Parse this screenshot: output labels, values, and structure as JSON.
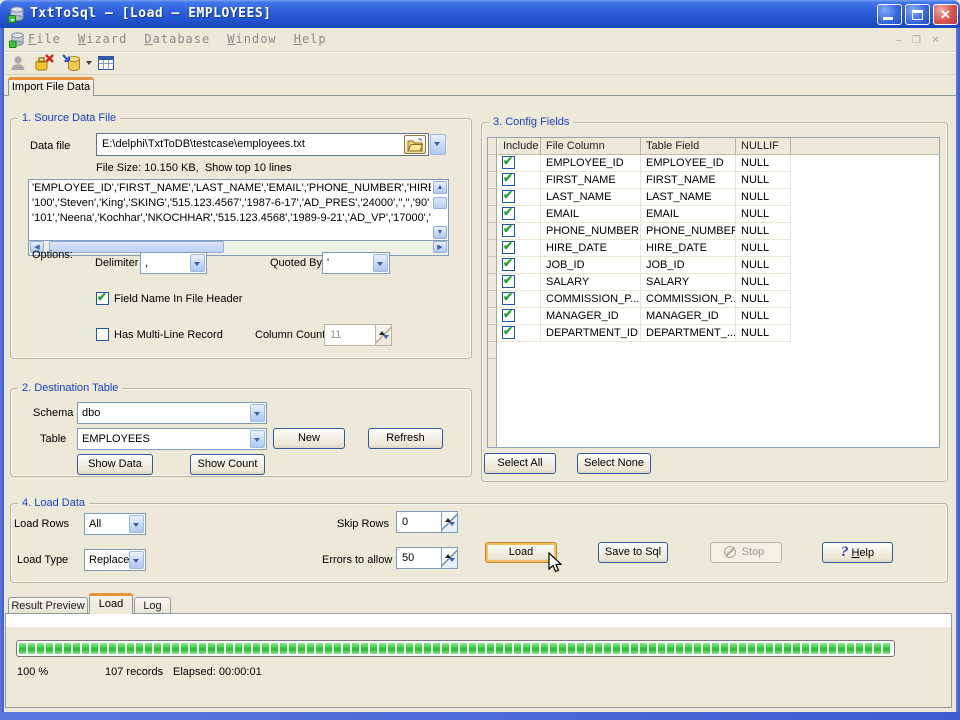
{
  "window": {
    "title": "TxtToSql – [Load – EMPLOYEES]"
  },
  "menu": {
    "items": [
      "File",
      "Wizard",
      "Database",
      "Window",
      "Help"
    ]
  },
  "tabs": {
    "main": "Import File Data"
  },
  "source": {
    "legend": "1. Source Data File",
    "data_file_label": "Data file",
    "data_file_value": "E:\\delphi\\TxtToDB\\testcase\\employees.txt",
    "file_info": "File Size: 10.150 KB,  Show top 10 lines",
    "preview_lines": [
      "'EMPLOYEE_ID','FIRST_NAME','LAST_NAME','EMAIL','PHONE_NUMBER','HIRE",
      "'100','Steven','King','SKING','515.123.4567','1987-6-17','AD_PRES','24000','','','90'",
      "'101','Neena','Kochhar','NKOCHHAR','515.123.4568','1989-9-21','AD_VP','17000','','"
    ],
    "options_label": "Options:",
    "delimiter_label": "Delimiter",
    "delimiter_value": ",",
    "quoted_by_label": "Quoted By",
    "quoted_by_value": "'",
    "field_name_checkbox": "Field Name In File Header",
    "field_name_checked": true,
    "multiline_checkbox": "Has Multi-Line Record",
    "multiline_checked": false,
    "column_count_label": "Column Count",
    "column_count_value": "11"
  },
  "destination": {
    "legend": "2. Destination Table",
    "schema_label": "Schema",
    "schema_value": "dbo",
    "table_label": "Table",
    "table_value": "EMPLOYEES",
    "new_button": "New",
    "refresh_button": "Refresh",
    "show_data_button": "Show Data",
    "show_count_button": "Show Count"
  },
  "config_fields": {
    "legend": "3. Config Fields",
    "columns": [
      "Include",
      "File Column",
      "Table Field",
      "NULLIF"
    ],
    "rows": [
      {
        "include": true,
        "file_column": "EMPLOYEE_ID",
        "table_field": "EMPLOYEE_ID",
        "nullif": "NULL"
      },
      {
        "include": true,
        "file_column": "FIRST_NAME",
        "table_field": "FIRST_NAME",
        "nullif": "NULL"
      },
      {
        "include": true,
        "file_column": "LAST_NAME",
        "table_field": "LAST_NAME",
        "nullif": "NULL"
      },
      {
        "include": true,
        "file_column": "EMAIL",
        "table_field": "EMAIL",
        "nullif": "NULL"
      },
      {
        "include": true,
        "file_column": "PHONE_NUMBER",
        "table_field": "PHONE_NUMBER",
        "nullif": "NULL"
      },
      {
        "include": true,
        "file_column": "HIRE_DATE",
        "table_field": "HIRE_DATE",
        "nullif": "NULL"
      },
      {
        "include": true,
        "file_column": "JOB_ID",
        "table_field": "JOB_ID",
        "nullif": "NULL"
      },
      {
        "include": true,
        "file_column": "SALARY",
        "table_field": "SALARY",
        "nullif": "NULL"
      },
      {
        "include": true,
        "file_column": "COMMISSION_P...",
        "table_field": "COMMISSION_P...",
        "nullif": "NULL"
      },
      {
        "include": true,
        "file_column": "MANAGER_ID",
        "table_field": "MANAGER_ID",
        "nullif": "NULL"
      },
      {
        "include": true,
        "file_column": "DEPARTMENT_ID",
        "table_field": "DEPARTMENT_...",
        "nullif": "NULL"
      }
    ],
    "select_all_button": "Select All",
    "select_none_button": "Select None"
  },
  "load_data": {
    "legend": "4. Load Data",
    "load_rows_label": "Load Rows",
    "load_rows_value": "All",
    "load_type_label": "Load Type",
    "load_type_value": "Replace",
    "skip_rows_label": "Skip Rows",
    "skip_rows_value": "0",
    "errors_label": "Errors to allow",
    "errors_value": "50",
    "load_button": "Load",
    "save_button": "Save to Sql",
    "stop_button": "Stop",
    "help_button": "Help"
  },
  "bottom_tabs": [
    "Result Preview",
    "Load",
    "Log"
  ],
  "progress": {
    "percent": "100 %",
    "records": "107 records",
    "elapsed": "Elapsed: 00:00:01"
  },
  "icons": {
    "check": "✔",
    "close": "✕",
    "help": "?",
    "mdi_minimize": "–",
    "mdi_restore": "❐",
    "mdi_close": "✕",
    "scroll_up": "▲",
    "scroll_down": "▼",
    "scroll_left": "◀",
    "scroll_right": "▶"
  },
  "colors": {
    "accent_blue": "#1B41C8",
    "check_green": "#21A32A",
    "progress_green": "#3ECB44",
    "tab_orange": "#E7913C",
    "titlebar_blue": "#2254CF",
    "client_bg": "#ECE9D8"
  }
}
